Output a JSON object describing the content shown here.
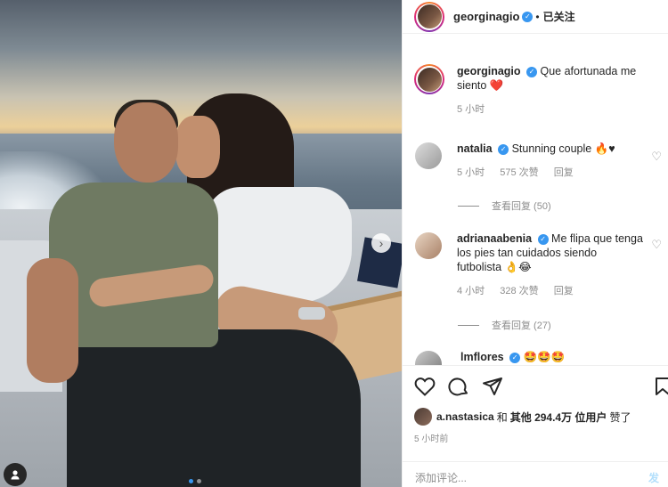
{
  "post": {
    "username": "georginagio",
    "follow_status": "已关注",
    "separator": "•"
  },
  "caption": {
    "username": "georginagio",
    "text": "Que afortunada me siento",
    "emoji": "❤️",
    "time": "5 小时"
  },
  "comments": [
    {
      "username": "natalia",
      "text": "Stunning couple 🔥♥",
      "time": "5 小时",
      "likes": "575 次赞",
      "reply": "回复",
      "view_replies": "查看回复 (50)"
    },
    {
      "username": "adrianaabenia",
      "text": "Me flipa que tenga los pies tan cuidados siendo futbolista 👌😂",
      "time": "4 小时",
      "likes": "328 次赞",
      "reply": "回复",
      "view_replies": "查看回复 (27)"
    },
    {
      "username": "lmflores",
      "text": "🤩🤩🤩"
    }
  ],
  "likes_line": {
    "username": "a.nastasica",
    "and": "和",
    "others": "其他 294.4万 位用户",
    "liked": "赞了"
  },
  "timestamp": "5 小时前",
  "add_comment": {
    "placeholder": "添加评论...",
    "post_label": "发布"
  },
  "colors": {
    "link_blue": "#3897f0",
    "heart_red": "#ed4956",
    "post_disabled": "#b2dffc"
  },
  "icons": [
    "heart-icon",
    "comment-icon",
    "share-icon",
    "bookmark-icon",
    "next-arrow-icon",
    "tag-user-icon",
    "verified-icon"
  ],
  "carousel": {
    "total": 2,
    "current": 1
  }
}
